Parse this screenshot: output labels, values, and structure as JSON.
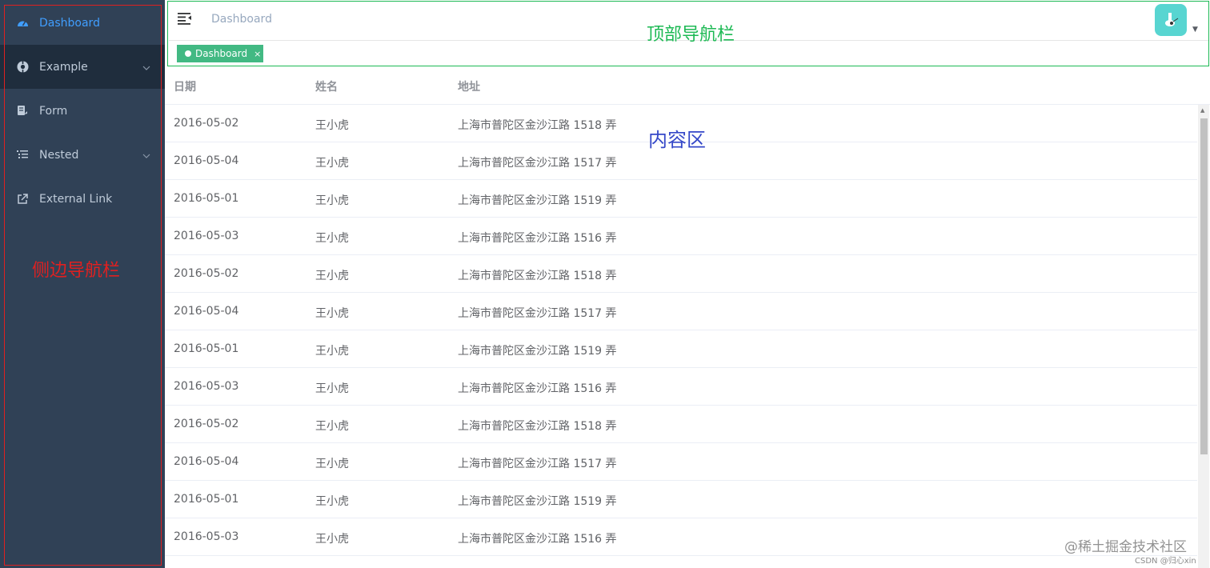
{
  "sidebar": {
    "items": [
      {
        "label": "Dashboard",
        "icon": "dashboard-icon"
      },
      {
        "label": "Example",
        "icon": "example-icon"
      },
      {
        "label": "Form",
        "icon": "form-icon"
      },
      {
        "label": "Nested",
        "icon": "nested-icon"
      },
      {
        "label": "External Link",
        "icon": "external-link-icon"
      }
    ],
    "annotation": "侧边导航栏"
  },
  "navbar": {
    "breadcrumb": "Dashboard",
    "tag_label": "Dashboard",
    "tag_close": "×",
    "annotation": "顶部导航栏"
  },
  "table": {
    "headers": [
      "日期",
      "姓名",
      "地址"
    ],
    "rows": [
      [
        "2016-05-02",
        "王小虎",
        "上海市普陀区金沙江路 1518 弄"
      ],
      [
        "2016-05-04",
        "王小虎",
        "上海市普陀区金沙江路 1517 弄"
      ],
      [
        "2016-05-01",
        "王小虎",
        "上海市普陀区金沙江路 1519 弄"
      ],
      [
        "2016-05-03",
        "王小虎",
        "上海市普陀区金沙江路 1516 弄"
      ],
      [
        "2016-05-02",
        "王小虎",
        "上海市普陀区金沙江路 1518 弄"
      ],
      [
        "2016-05-04",
        "王小虎",
        "上海市普陀区金沙江路 1517 弄"
      ],
      [
        "2016-05-01",
        "王小虎",
        "上海市普陀区金沙江路 1519 弄"
      ],
      [
        "2016-05-03",
        "王小虎",
        "上海市普陀区金沙江路 1516 弄"
      ],
      [
        "2016-05-02",
        "王小虎",
        "上海市普陀区金沙江路 1518 弄"
      ],
      [
        "2016-05-04",
        "王小虎",
        "上海市普陀区金沙江路 1517 弄"
      ],
      [
        "2016-05-01",
        "王小虎",
        "上海市普陀区金沙江路 1519 弄"
      ],
      [
        "2016-05-03",
        "王小虎",
        "上海市普陀区金沙江路 1516 弄"
      ]
    ]
  },
  "content": {
    "annotation": "内容区"
  },
  "watermark": {
    "main": "@稀土掘金技术社区",
    "sub": "CSDN @归心xin"
  },
  "colors": {
    "sidebar_bg": "#304156",
    "active": "#409eff",
    "tag": "#42b983",
    "sidebar_annotation": "#e02020",
    "navbar_annotation": "#1db954",
    "content_annotation": "#3548c8"
  }
}
